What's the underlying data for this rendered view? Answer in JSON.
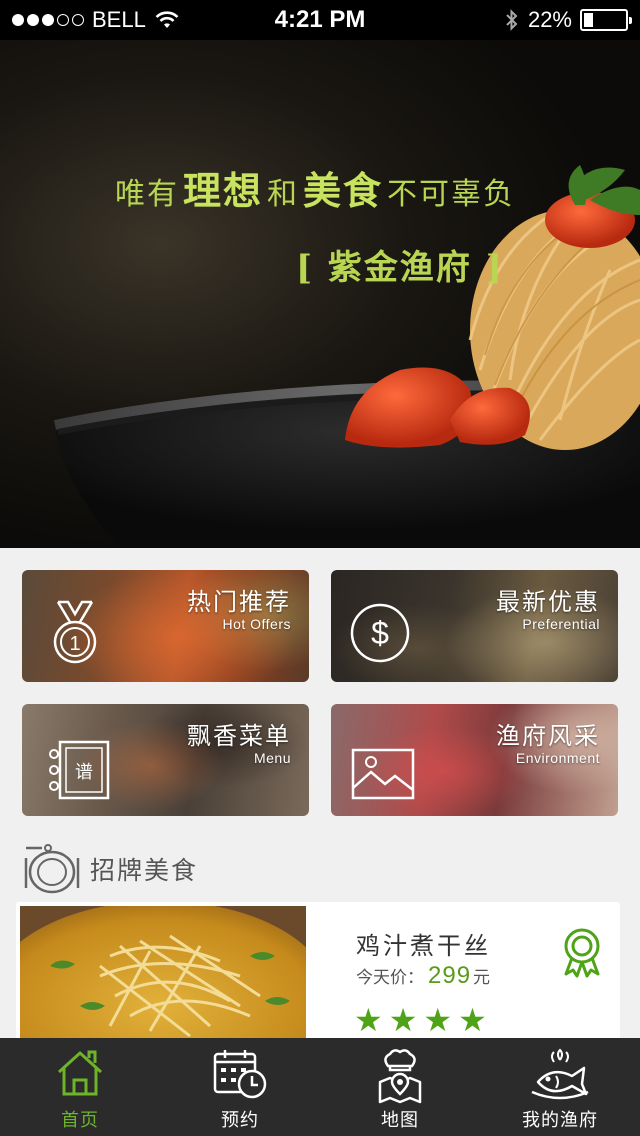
{
  "status_bar": {
    "carrier": "BELL",
    "time": "4:21 PM",
    "battery": "22%",
    "battery_level": 0.22
  },
  "hero": {
    "slogan_parts": [
      "唯有",
      "理想",
      "和",
      "美食",
      "不可辜负"
    ],
    "brand": "[ 紫金渔府 ]"
  },
  "features": [
    {
      "title": "热门推荐",
      "subtitle": "Hot Offers",
      "icon": "medal-icon"
    },
    {
      "title": "最新优惠",
      "subtitle": "Preferential",
      "icon": "dollar-icon"
    },
    {
      "title": "飘香菜单",
      "subtitle": "Menu",
      "icon": "menu-book-icon",
      "icon_text": "谱"
    },
    {
      "title": "渔府风采",
      "subtitle": "Environment",
      "icon": "picture-icon"
    }
  ],
  "section": {
    "title": "招牌美食",
    "icon": "plate-cloche-icon"
  },
  "dish": {
    "name": "鸡汁煮干丝",
    "price_label": "今天价：",
    "price": "299",
    "unit": "元",
    "rating": 4,
    "badge_icon": "award-ribbon-icon"
  },
  "tabs": [
    {
      "label": "首页",
      "icon": "home-icon",
      "active": true
    },
    {
      "label": "预约",
      "icon": "calendar-clock-icon",
      "active": false
    },
    {
      "label": "地图",
      "icon": "chef-map-icon",
      "active": false
    },
    {
      "label": "我的渔府",
      "icon": "fish-dish-icon",
      "active": false
    }
  ],
  "colors": {
    "accent": "#6db429",
    "price": "#5a9a1a",
    "slogan": "#b9d653",
    "tab_bar": "#2b2b2b"
  }
}
